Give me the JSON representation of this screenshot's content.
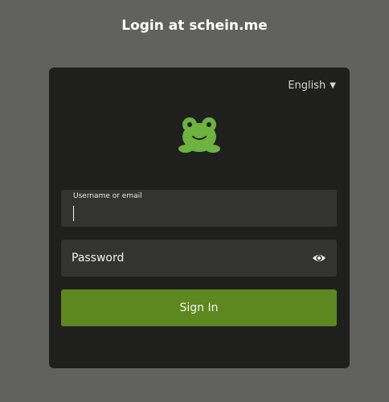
{
  "header": {
    "title": "Login at schein.me"
  },
  "language": {
    "selected": "English",
    "caret": "▼"
  },
  "logo": {
    "icon": "frog-logo-icon",
    "color": "#6cb33f"
  },
  "form": {
    "username": {
      "label": "Username or email",
      "value": ""
    },
    "password": {
      "placeholder": "Password",
      "value": "",
      "reveal_icon": "eye-icon"
    },
    "submit_label": "Sign In"
  },
  "colors": {
    "background": "#61615d",
    "card": "#1f1f1e",
    "field": "#333332",
    "accent": "#5d871f"
  }
}
